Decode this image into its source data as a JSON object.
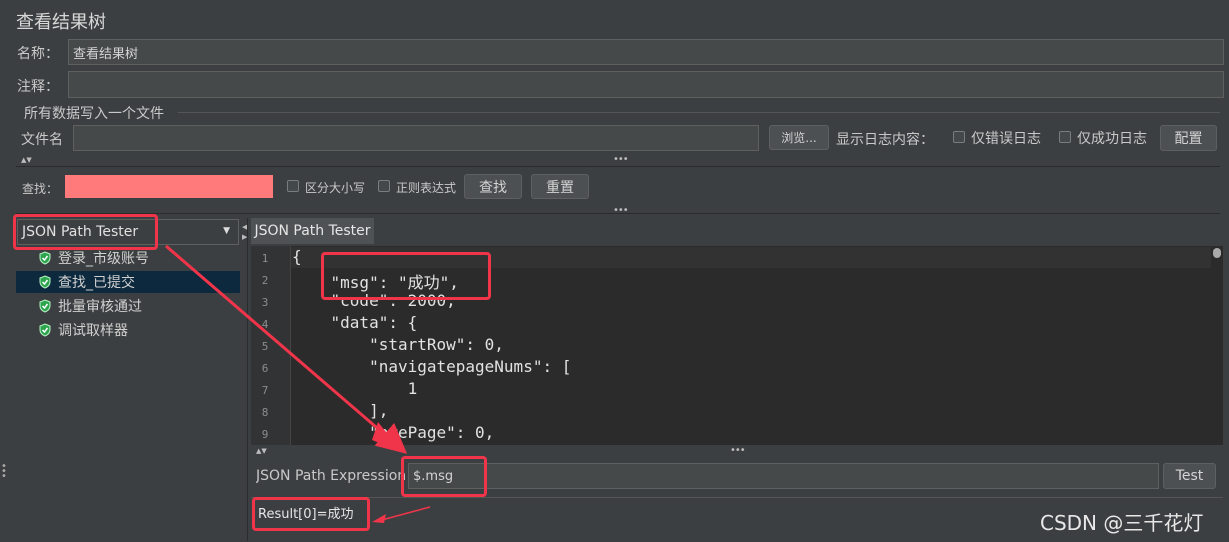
{
  "header": {
    "title": "查看结果树"
  },
  "form": {
    "name_label": "名称：",
    "name_value": "查看结果树",
    "comment_label": "注释：",
    "comment_value": "",
    "group_label": "所有数据写入一个文件",
    "filename_label": "文件名",
    "filename_value": "",
    "browse_label": "浏览...",
    "log_content_label": "显示日志内容：",
    "errors_only_label": "仅错误日志",
    "success_only_label": "仅成功日志",
    "config_label": "配置"
  },
  "search": {
    "label": "查找：",
    "value": "",
    "case_label": "区分大小写",
    "regex_label": "正则表达式",
    "find_label": "查找",
    "reset_label": "重置"
  },
  "renderer": {
    "selected": "JSON Path Tester"
  },
  "tree": {
    "items": [
      {
        "label": "登录_市级账号",
        "selected": false
      },
      {
        "label": "查找_已提交",
        "selected": true
      },
      {
        "label": "批量审核通过",
        "selected": false
      },
      {
        "label": "调试取样器",
        "selected": false
      }
    ]
  },
  "tab": {
    "label": "JSON Path Tester"
  },
  "code": {
    "line_numbers": [
      "1",
      "2",
      "3",
      "4",
      "5",
      "6",
      "7",
      "8",
      "9"
    ],
    "lines": [
      "{",
      "    \"msg\": \"成功\",",
      "    \"code\": 2000,",
      "    \"data\": {",
      "        \"startRow\": 0,",
      "        \"navigatepageNums\": [",
      "            1",
      "        ],",
      "        \"prePage\": 0,"
    ]
  },
  "expression": {
    "label": "JSON Path Expression",
    "value": "$.msg",
    "test_label": "Test"
  },
  "result": {
    "text": "Result[0]=成功"
  },
  "watermark": "CSDN @三千花灯",
  "colors": {
    "annotation_red": "#f0354a",
    "search_highlight": "#ff7b7b",
    "selected_row": "#0d293e"
  }
}
